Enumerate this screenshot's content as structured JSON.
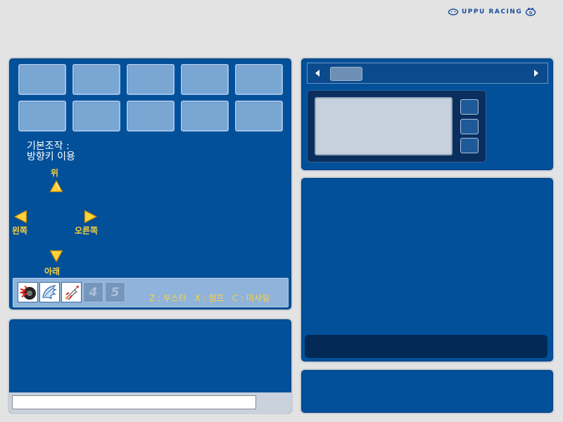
{
  "brand": {
    "logo_text": "UPPU RACING"
  },
  "controls": {
    "basic_title": "기본조작 :",
    "basic_desc": "방향키 이용",
    "up_label": "위",
    "left_label": "왼쪽",
    "right_label": "오른쪽",
    "down_label": "아래"
  },
  "items": {
    "slot4_number": "4",
    "slot5_number": "5",
    "keys_text": "Z : 부스터   X : 점프   C : 미사일"
  },
  "chat": {
    "input_value": "",
    "input_placeholder": ""
  },
  "colors": {
    "panel": "#02509a",
    "background": "#e3e3e3",
    "accent_yellow": "#ffd23a",
    "slot": "#7aa6d4"
  }
}
